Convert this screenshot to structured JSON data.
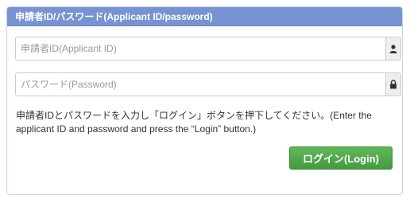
{
  "panel": {
    "title": "申請者ID/パスワード(Applicant ID/password)"
  },
  "form": {
    "applicant_id_placeholder": "申請者ID(Applicant ID)",
    "applicant_id_value": "",
    "password_placeholder": "パスワード(Password)",
    "password_value": "",
    "user_icon": "user-icon",
    "lock_icon": "lock-icon"
  },
  "instructions": "申請者IDとパスワードを入力し「ログイン」ボタンを押下してください。(Enter the applicant ID and password and press the “Login” button.)",
  "login_button": {
    "label": "ログイン(Login)"
  },
  "colors": {
    "header_bg": "#7893d1",
    "button_bg": "#4ea84a",
    "border": "#c9d3e6"
  }
}
